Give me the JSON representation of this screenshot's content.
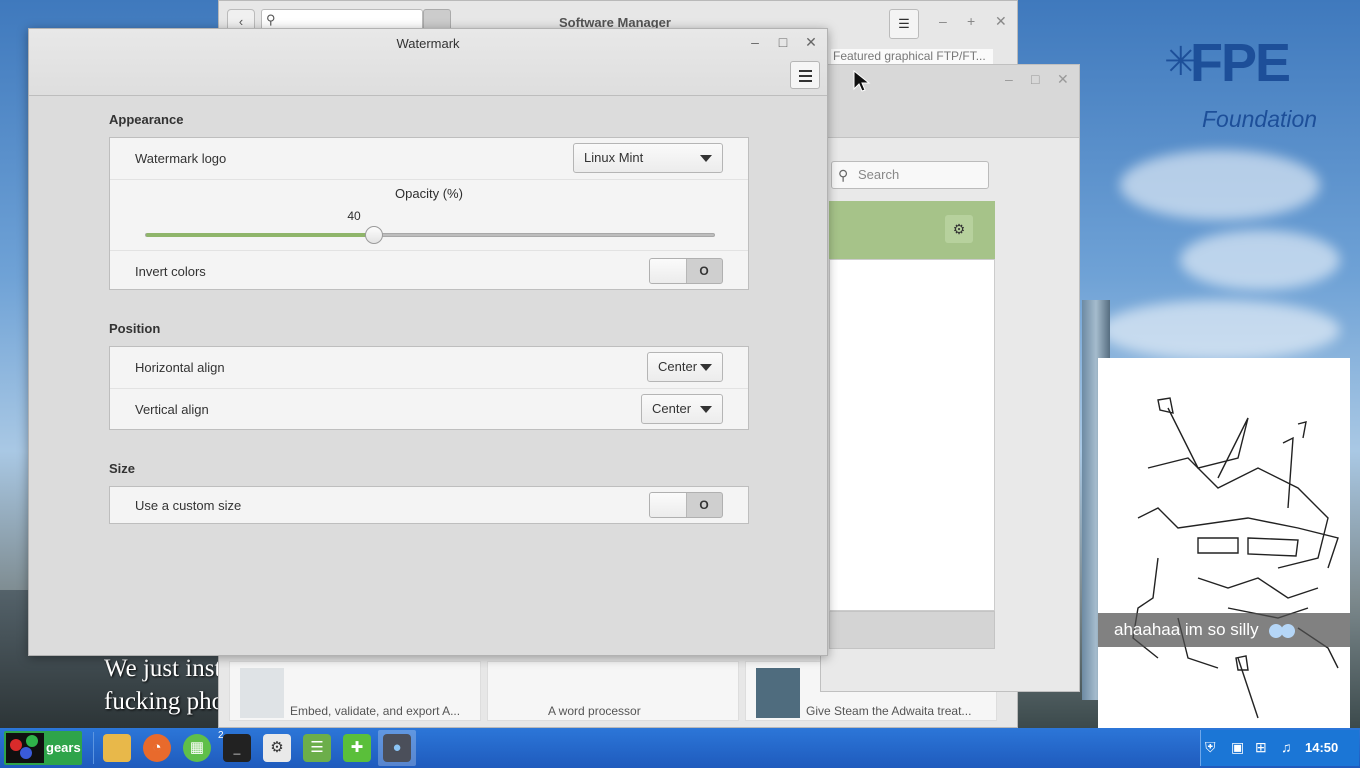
{
  "desktop": {
    "logo_main": "FPE",
    "logo_sub": "Foundation",
    "meme_line1": "We just instal",
    "meme_line2": "fucking phone",
    "caption": "ahaahaa im so silly"
  },
  "software_manager": {
    "title": "Software Manager",
    "featured_text": "Featured graphical FTP/FT...",
    "cards": [
      {
        "desc": "Embed, validate, and export A..."
      },
      {
        "desc": "A word processor"
      },
      {
        "desc": "Give Steam the Adwaita treat..."
      }
    ]
  },
  "middle_window": {
    "search_placeholder": "Search"
  },
  "watermark": {
    "title": "Watermark",
    "appearance": {
      "heading": "Appearance",
      "logo_label": "Watermark logo",
      "logo_value": "Linux Mint",
      "opacity_label": "Opacity (%)",
      "opacity_value": "40",
      "opacity_fraction": 0.4,
      "invert_label": "Invert colors",
      "invert_state": "O"
    },
    "position": {
      "heading": "Position",
      "h_label": "Horizontal align",
      "h_value": "Center",
      "v_label": "Vertical align",
      "v_value": "Center"
    },
    "size": {
      "heading": "Size",
      "custom_label": "Use a custom size",
      "custom_state": "O"
    }
  },
  "taskbar": {
    "start_label": "gears",
    "terminal_badge": "2",
    "clock": "14:50",
    "colors": {
      "bar": "#1f5bbd",
      "start": "#2ea44a"
    }
  }
}
